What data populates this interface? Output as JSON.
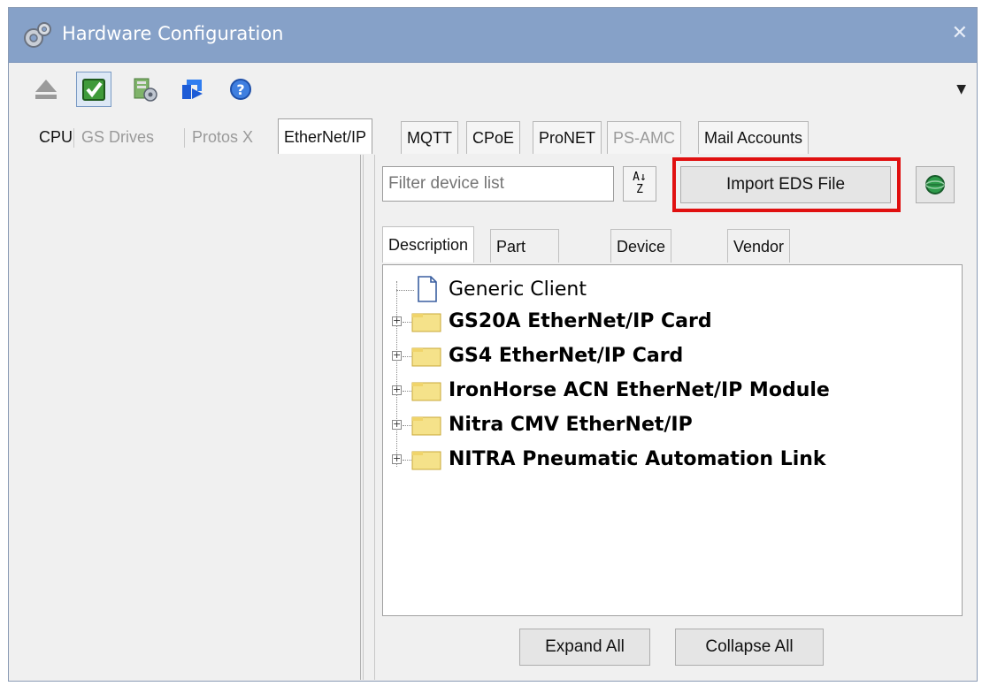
{
  "window": {
    "title": "Hardware Configuration",
    "close_glyph": "✕",
    "title_bar_color": "#86a1c8"
  },
  "toolbar": {
    "buttons": [
      {
        "icon": "eject-icon"
      },
      {
        "icon": "check-icon"
      },
      {
        "icon": "module-settings-icon"
      },
      {
        "icon": "import-arrow-icon"
      },
      {
        "icon": "help-icon"
      }
    ],
    "dropdown_glyph": "▼"
  },
  "tabs": [
    {
      "label": "CPU",
      "state": "normal"
    },
    {
      "label": "GS Drives",
      "state": "disabled"
    },
    {
      "label": "Protos X",
      "state": "disabled"
    },
    {
      "label": "EtherNet/IP",
      "state": "active"
    },
    {
      "label": "MQTT",
      "state": "normal"
    },
    {
      "label": "CPoE",
      "state": "normal"
    },
    {
      "label": "ProNET",
      "state": "normal"
    },
    {
      "label": "PS-AMC",
      "state": "disabled"
    },
    {
      "label": "Mail Accounts",
      "state": "normal"
    }
  ],
  "device_panel": {
    "filter_placeholder": "Filter device list",
    "sort_glyph_top": "A",
    "sort_glyph_bottom": "Z",
    "import_button": "Import EDS File",
    "highlight_color": "#e01010",
    "subtabs": [
      {
        "label": "Description",
        "active": true
      },
      {
        "label": "Part Number",
        "active": false
      },
      {
        "label": "Device Type",
        "active": false
      },
      {
        "label": "Vendor",
        "active": false
      }
    ],
    "tree": [
      {
        "label": "Generic Client",
        "kind": "document",
        "bold": false
      },
      {
        "label": "GS20A EtherNet/IP Card",
        "kind": "folder",
        "bold": true
      },
      {
        "label": "GS4 EtherNet/IP Card",
        "kind": "folder",
        "bold": true
      },
      {
        "label": "IronHorse ACN EtherNet/IP Module",
        "kind": "folder",
        "bold": true
      },
      {
        "label": "Nitra CMV EtherNet/IP",
        "kind": "folder",
        "bold": true
      },
      {
        "label": "NITRA Pneumatic Automation Link",
        "kind": "folder",
        "bold": true
      }
    ],
    "expand_all": "Expand All",
    "collapse_all": "Collapse All"
  }
}
